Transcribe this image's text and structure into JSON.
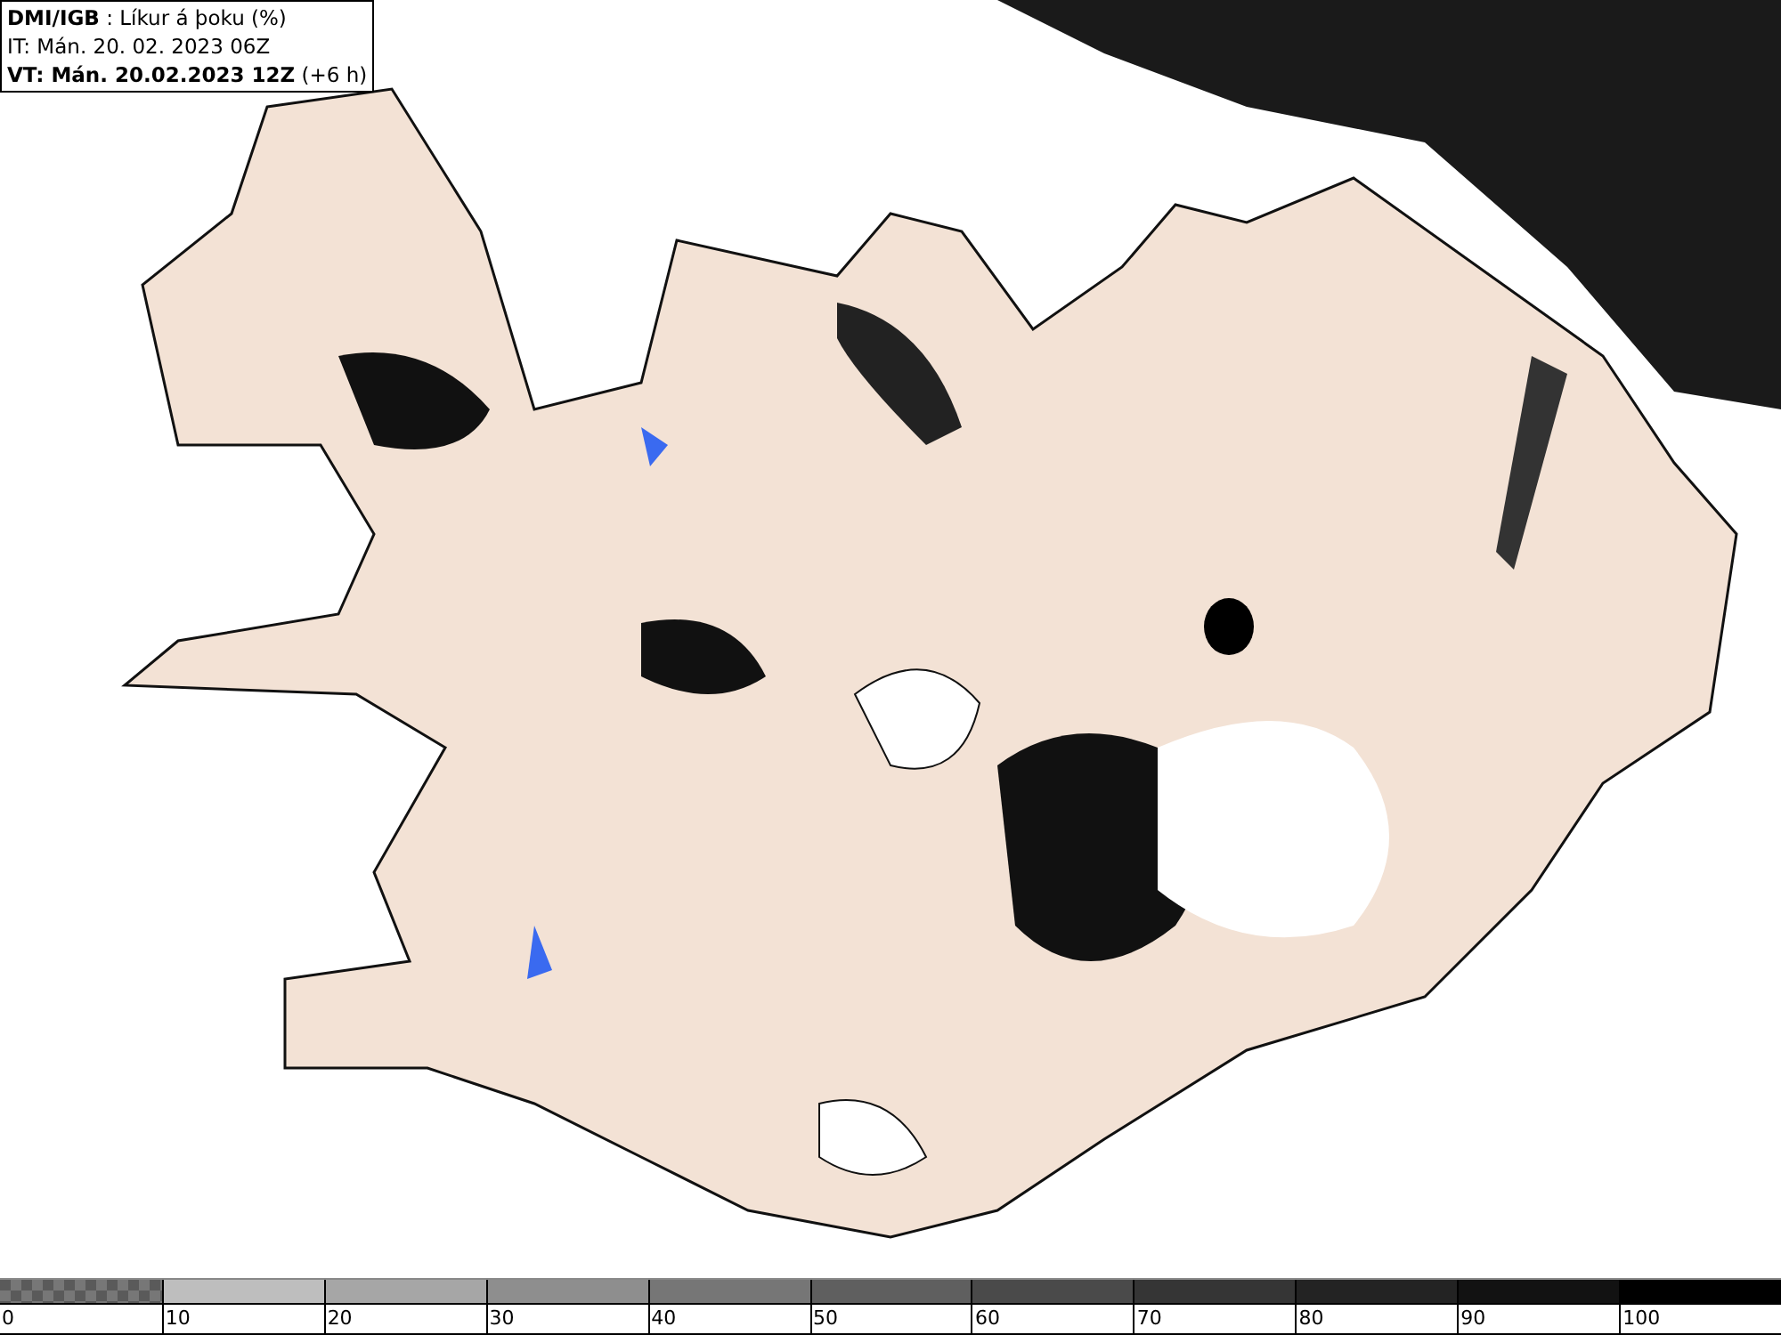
{
  "header": {
    "source": "DMI/IGB",
    "title": ": Líkur á þoku (%)",
    "issue_time": "IT: Mán. 20. 02. 2023 06Z",
    "valid_time": "VT: Mán. 20.02.2023 12Z",
    "offset": "(+6 h)"
  },
  "legend": [
    {
      "kind": "checker",
      "color": "#5a5a5a",
      "label": "0"
    },
    {
      "kind": "solid",
      "color": "#bebebe",
      "label": "10"
    },
    {
      "kind": "solid",
      "color": "#a6a6a6",
      "label": "20"
    },
    {
      "kind": "solid",
      "color": "#8e8e8e",
      "label": "30"
    },
    {
      "kind": "solid",
      "color": "#767676",
      "label": "40"
    },
    {
      "kind": "solid",
      "color": "#5f5f5f",
      "label": "50"
    },
    {
      "kind": "solid",
      "color": "#4a4a4a",
      "label": "60"
    },
    {
      "kind": "solid",
      "color": "#353535",
      "label": "70"
    },
    {
      "kind": "solid",
      "color": "#232323",
      "label": "80"
    },
    {
      "kind": "solid",
      "color": "#121212",
      "label": "90"
    },
    {
      "kind": "solid",
      "color": "#000000",
      "label": "100"
    }
  ]
}
